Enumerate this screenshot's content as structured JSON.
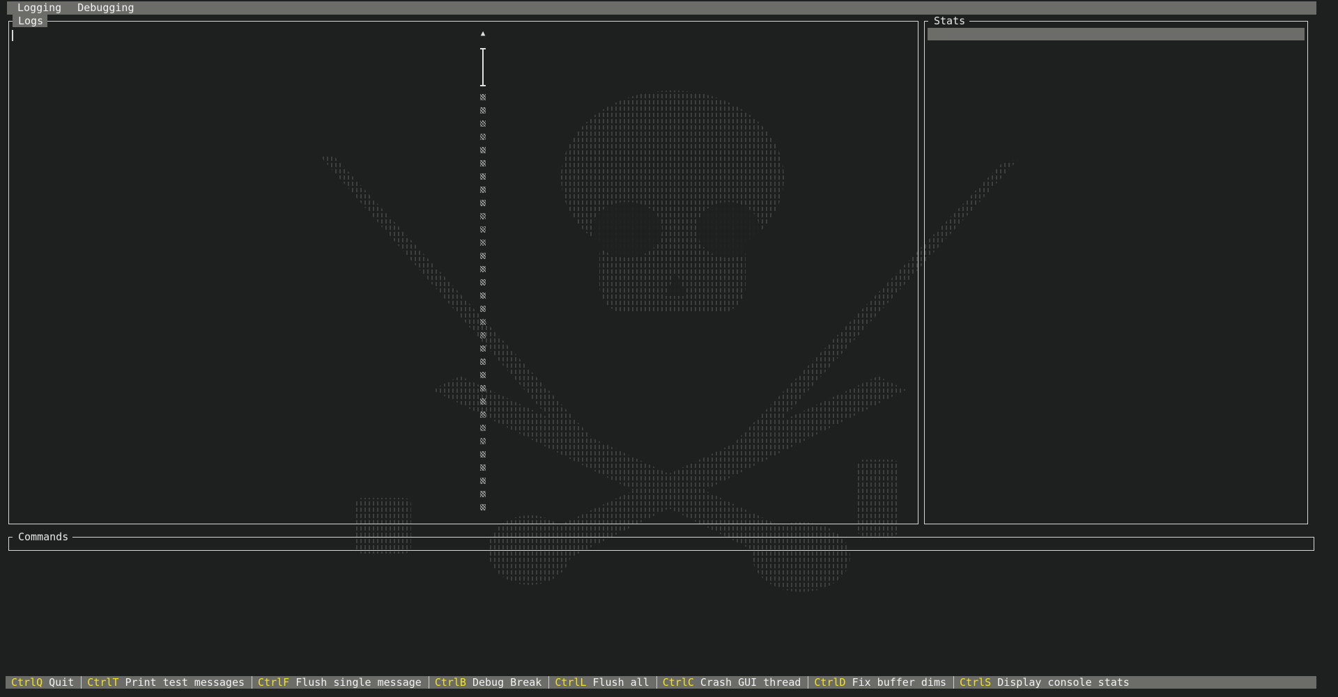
{
  "menubar": {
    "items": [
      {
        "label": "Logging"
      },
      {
        "label": "Debugging"
      }
    ]
  },
  "panels": {
    "logs": {
      "title": "Logs"
    },
    "stats": {
      "title": "Stats"
    },
    "commands": {
      "title": "Commands"
    }
  },
  "scrollbar": {
    "up_arrow": "▲"
  },
  "statusbar": {
    "shortcuts": [
      {
        "key": "CtrlQ",
        "label": "Quit"
      },
      {
        "key": "CtrlT",
        "label": "Print test messages"
      },
      {
        "key": "CtrlF",
        "label": "Flush single message"
      },
      {
        "key": "CtrlB",
        "label": "Debug Break"
      },
      {
        "key": "CtrlL",
        "label": "Flush all"
      },
      {
        "key": "CtrlC",
        "label": "Crash GUI thread"
      },
      {
        "key": "CtrlD",
        "label": "Fix buffer dims"
      },
      {
        "key": "CtrlS",
        "label": "Display console stats"
      }
    ]
  },
  "theme": {
    "background": "#1e1f1f",
    "bar": "#6c6d68",
    "shortcut_key": "#f5e21c",
    "border": "#d8d8d8",
    "background_art": "jolly-roger-skull-and-crossed-swords"
  }
}
